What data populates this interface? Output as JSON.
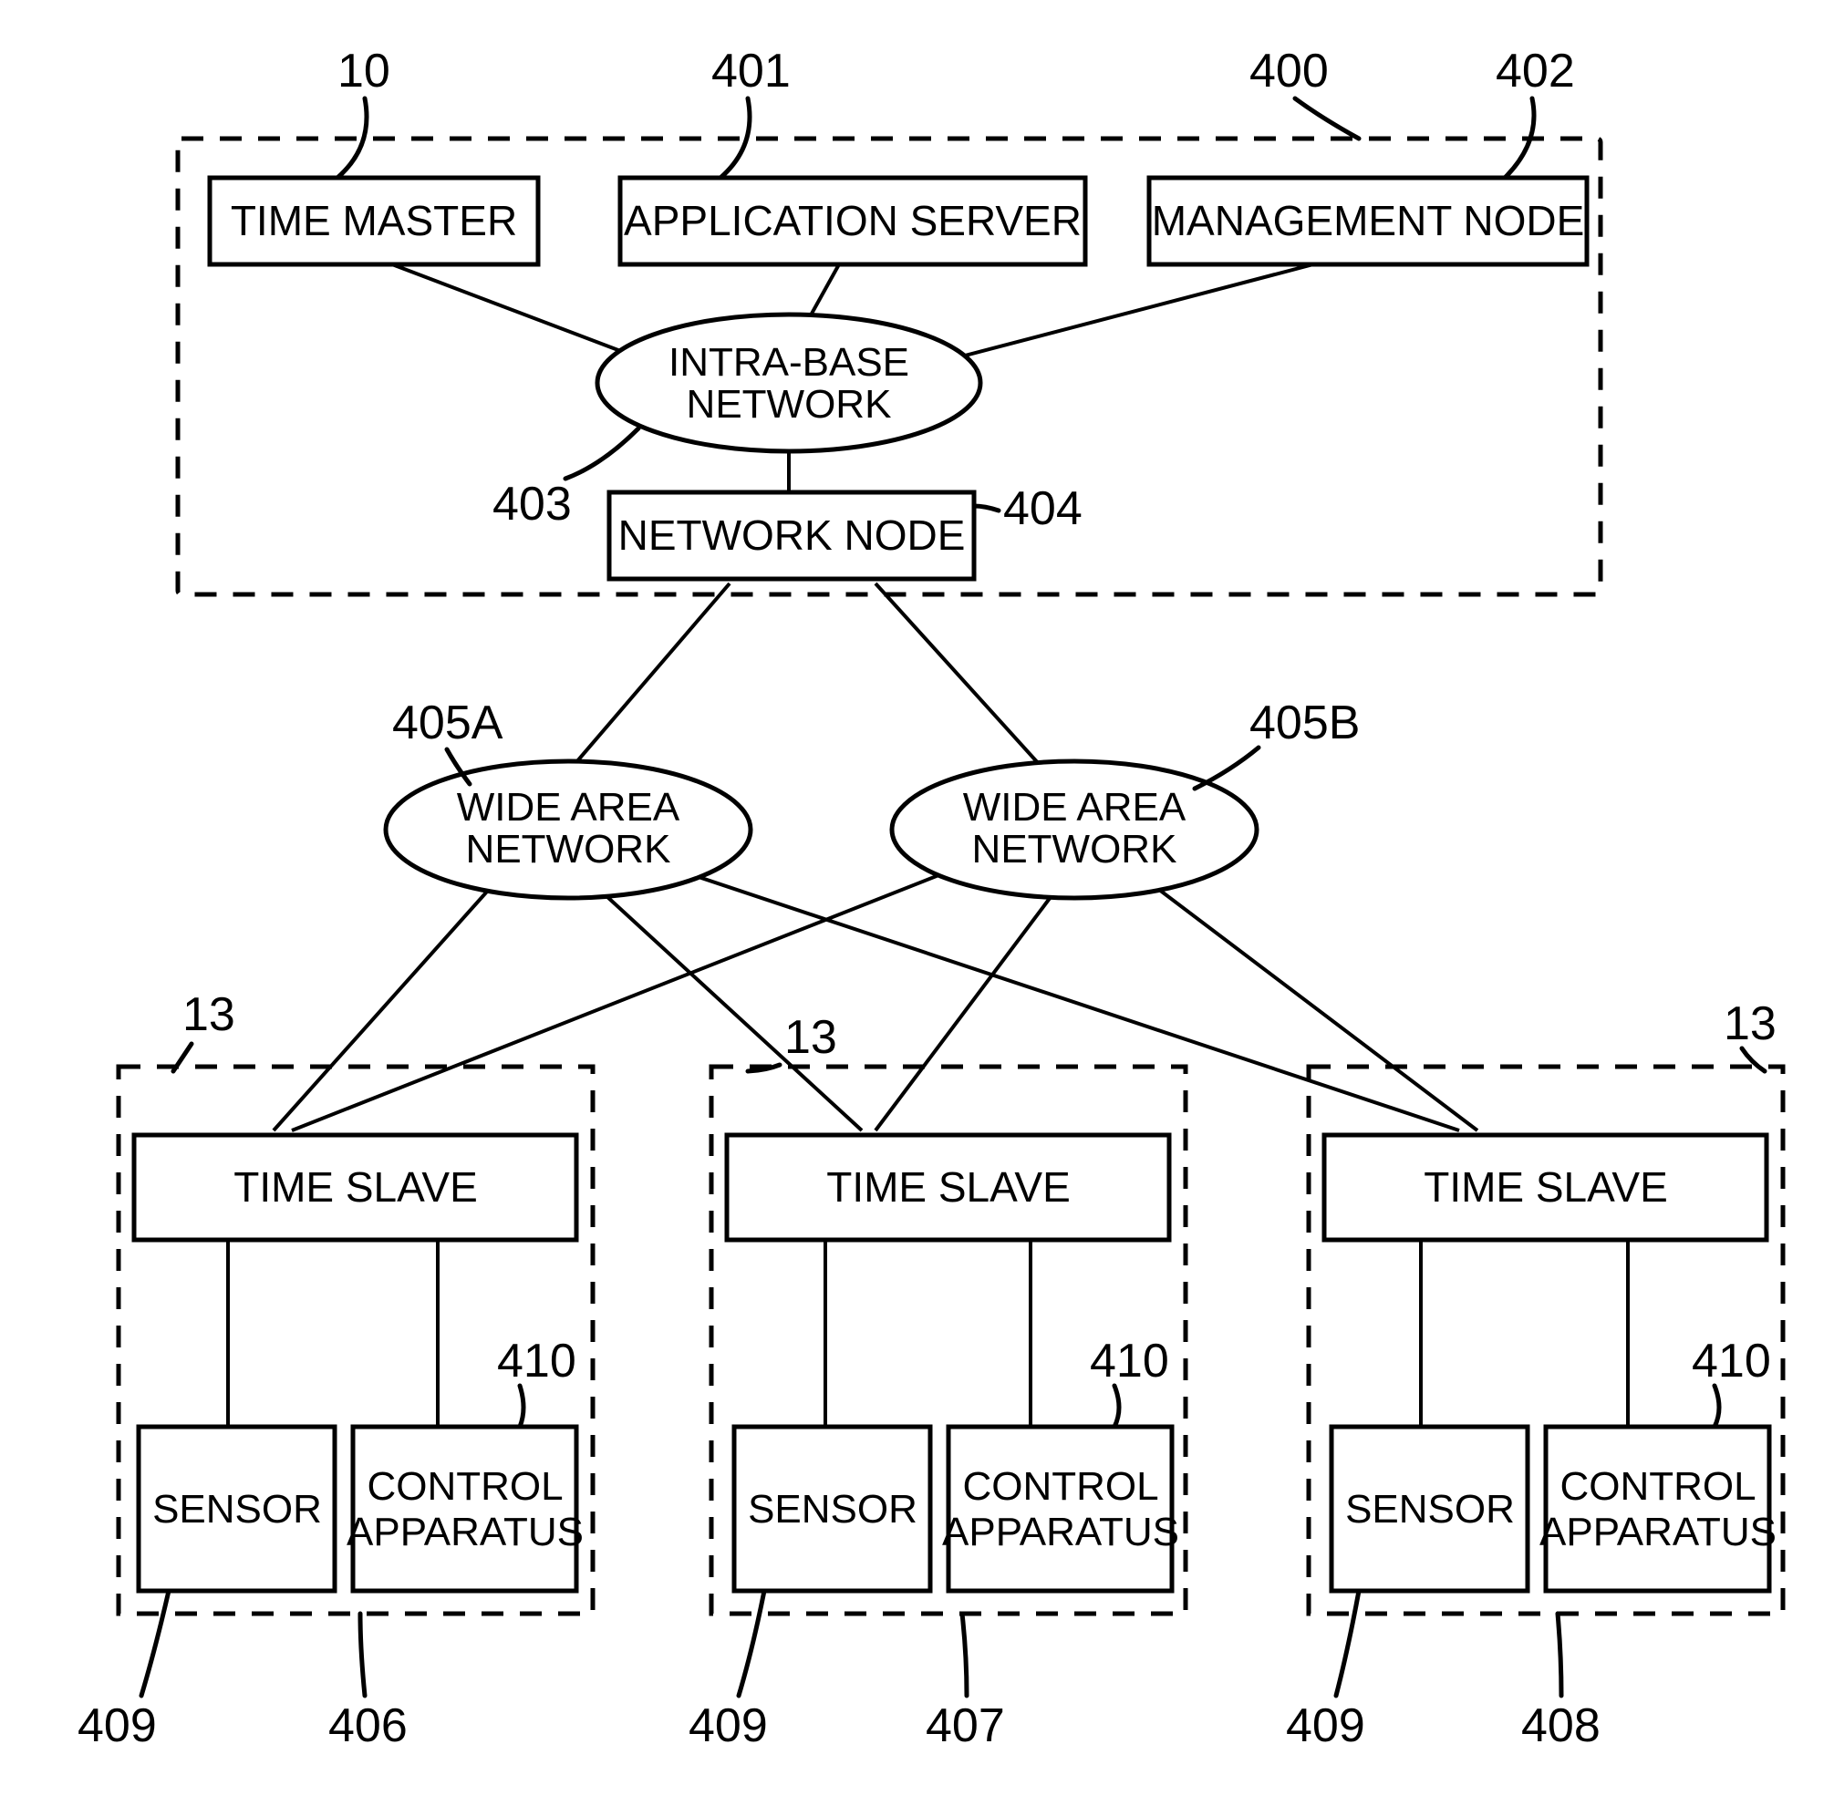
{
  "refs": {
    "r10": "10",
    "r400": "400",
    "r401": "401",
    "r402": "402",
    "r403": "403",
    "r404": "404",
    "r405a": "405A",
    "r405b": "405B",
    "r13a": "13",
    "r13b": "13",
    "r13c": "13",
    "r406": "406",
    "r407": "407",
    "r408": "408",
    "r409a": "409",
    "r409b": "409",
    "r409c": "409",
    "r410a": "410",
    "r410b": "410",
    "r410c": "410"
  },
  "labels": {
    "time_master": "TIME MASTER",
    "app_server": "APPLICATION SERVER",
    "mgmt_node": "MANAGEMENT NODE",
    "intra_base_l1": "INTRA-BASE",
    "intra_base_l2": "NETWORK",
    "network_node": "NETWORK NODE",
    "wan_l1": "WIDE AREA",
    "wan_l2": "NETWORK",
    "time_slave": "TIME SLAVE",
    "sensor": "SENSOR",
    "control_l1": "CONTROL",
    "control_l2": "APPARATUS"
  }
}
